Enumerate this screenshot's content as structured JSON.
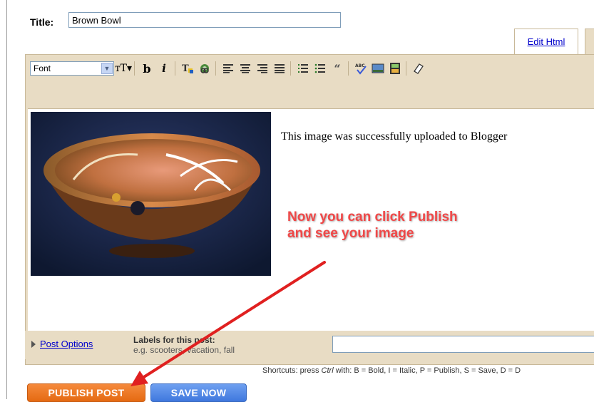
{
  "post": {
    "title_label": "Title:",
    "title_value": "Brown Bowl"
  },
  "tabs": {
    "edit_html": "Edit Html"
  },
  "toolbar": {
    "font_label": "Font",
    "icons": [
      "font-size-icon",
      "bold-icon",
      "italic-icon",
      "text-color-icon",
      "link-icon",
      "align-left-icon",
      "align-center-icon",
      "align-right-icon",
      "justify-icon",
      "numbered-list-icon",
      "bullet-list-icon",
      "blockquote-icon",
      "spell-check-icon",
      "image-icon",
      "video-icon",
      "eraser-icon"
    ]
  },
  "content": {
    "body_text": "This image was successfully uploaded to Blogger"
  },
  "annotation": {
    "line1": "Now you can click Publish",
    "line2": "and see your image",
    "color": "#f04848"
  },
  "footer": {
    "post_options": "Post Options",
    "labels_title": "Labels for this post:",
    "labels_example": "e.g. scooters, vacation, fall",
    "shortcuts_prefix": "Shortcuts: press",
    "shortcuts_key": "Ctrl",
    "shortcuts_rest": "with: B = Bold, I = Italic, P = Publish, S = Save, D = D"
  },
  "buttons": {
    "publish": "PUBLISH POST",
    "publish_color": "#f07a28",
    "save": "SAVE NOW",
    "save_color": "#5a8ee8"
  }
}
